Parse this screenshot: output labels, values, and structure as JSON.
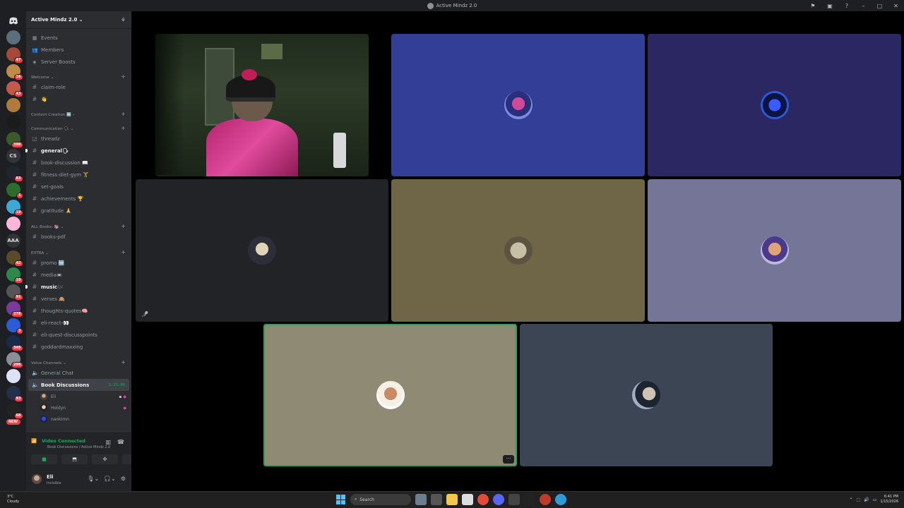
{
  "window": {
    "title": "Active Mindz 2.0"
  },
  "servers": [
    {
      "ping": ""
    },
    {
      "ping": "47"
    },
    {
      "ping": "16"
    },
    {
      "ping": "43"
    },
    {
      "ping": ""
    },
    {
      "ping": ""
    },
    {
      "ping": "398"
    },
    {
      "ping": "",
      "text": "CS"
    },
    {
      "ping": "83"
    },
    {
      "ping": "1"
    },
    {
      "ping": "19"
    },
    {
      "ping": ""
    },
    {
      "ping": "",
      "text": "AAA"
    },
    {
      "ping": "42"
    },
    {
      "ping": "10"
    },
    {
      "ping": "91"
    },
    {
      "ping": "278"
    },
    {
      "ping": "3"
    },
    {
      "ping": "345"
    },
    {
      "ping": "296"
    },
    {
      "ping": ""
    },
    {
      "ping": "93"
    },
    {
      "ping": "68"
    }
  ],
  "new_label": "NEW",
  "sidebar": {
    "server_name": "Active Mindz 2.0",
    "nav": [
      {
        "label": "Events"
      },
      {
        "label": "Members"
      },
      {
        "label": "Server Boosts"
      }
    ],
    "categories": {
      "welcome": "Welcome",
      "content": "Content Creation 🆕",
      "communication": "Communication 🗣",
      "books": "ALL Books: 📚",
      "extra": "EXTRA",
      "voice": "Voice Channels"
    },
    "channels": {
      "claim_role": "claim-role",
      "wave": "👋",
      "threadz": "threadz",
      "general": "general🗣",
      "book_discussion": "book-discussion 📖",
      "fitness": "fitness-diet-gym 🏋",
      "set_goals": "set-goals",
      "achievements": "achievements 🏆",
      "gratitude": "gratitude 🙏",
      "books_pdf": "books-pdf",
      "promo": "promo 🆓",
      "media": "media📼",
      "music": "music🎶",
      "verses": "verses 🙈",
      "thoughts": "thoughts-quotes🧠",
      "eli_react": "eli-react-👀",
      "eli_quest": "eli-quest-discusspoints",
      "goddard": "goddardmaxxing",
      "general_chat": "General Chat",
      "book_discussions_voice": "Book Discussions"
    },
    "voice_timer": "1:25:09",
    "voice_users": [
      {
        "name": "Eli"
      },
      {
        "name": "Holdyn"
      },
      {
        "name": "naokimn"
      }
    ]
  },
  "voice_panel": {
    "status": "Video Connected",
    "location": "Book Discussions / Active Mindz 2.0"
  },
  "user": {
    "name": "Eli",
    "status": "Invisible"
  },
  "taskbar": {
    "temp": "3°C",
    "weather": "Cloudy",
    "search": "Search",
    "time": "6:41 PM",
    "date": "1/15/2026"
  },
  "colors": {
    "tile_1": "#333f96",
    "tile_2": "#2a2762",
    "tile_3": "#222327",
    "tile_4": "#6f6547",
    "tile_5": "#757598",
    "tile_6": "#8f8a74",
    "tile_7": "#3b4553",
    "speaking": "#23a55a"
  }
}
